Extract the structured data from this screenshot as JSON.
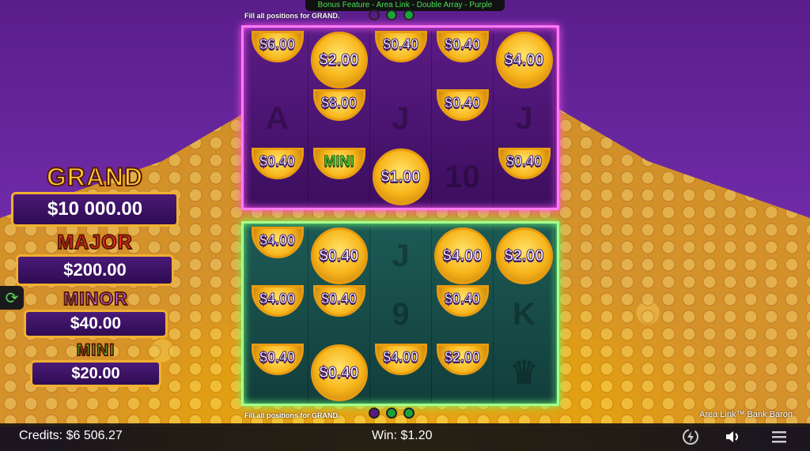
{
  "banner": "Bonus Feature - Area Link - Double Array - Purple",
  "hint": "Fill all positions for GRAND.",
  "top_grid": [
    [
      {
        "coin": "$6.00",
        "partial": true
      },
      {
        "coin": "$2.00"
      },
      {
        "coin": "$0.40",
        "partial": true
      },
      {
        "coin": "$0.40",
        "partial": true
      },
      {
        "coin": "$4.00"
      }
    ],
    [
      {
        "sym": "A"
      },
      {
        "coin": "$8.00",
        "partial": true
      },
      {
        "sym": "J"
      },
      {
        "coin": "$0.40",
        "partial": true
      },
      {
        "sym": "J"
      }
    ],
    [
      {
        "coin": "$0.40",
        "partial": true
      },
      {
        "coin": "MINI",
        "partial": true,
        "mini": true
      },
      {
        "coin": "$1.00"
      },
      {
        "sym": "10"
      },
      {
        "coin": "$0.40",
        "partial": true
      }
    ]
  ],
  "bottom_grid": [
    [
      {
        "coin": "$4.00",
        "partial": true
      },
      {
        "coin": "$0.40"
      },
      {
        "sym": "J"
      },
      {
        "coin": "$4.00"
      },
      {
        "coin": "$2.00"
      }
    ],
    [
      {
        "coin": "$4.00",
        "partial": true
      },
      {
        "coin": "$0.40",
        "partial": true
      },
      {
        "sym": "9"
      },
      {
        "coin": "$0.40",
        "partial": true
      },
      {
        "sym": "K"
      }
    ],
    [
      {
        "coin": "$0.40",
        "partial": true
      },
      {
        "coin": "$0.40"
      },
      {
        "coin": "$4.00",
        "partial": true
      },
      {
        "coin": "$2.00",
        "partial": true
      },
      {
        "sym": "♛"
      }
    ]
  ],
  "jackpots": {
    "grand": {
      "label": "GRAND",
      "value": "$10 000.00"
    },
    "major": {
      "label": "MAJOR",
      "value": "$200.00"
    },
    "minor": {
      "label": "MINOR",
      "value": "$40.00"
    },
    "mini": {
      "label": "MINI",
      "value": "$20.00"
    }
  },
  "brand": "Area Link™ Bank Baron",
  "credits": "Credits: $6 506.27",
  "win": "Win: $1.20",
  "colors": {
    "grand": "#ffcf3a",
    "major": "#ff3030",
    "minor": "#c070ff",
    "mini": "#50e040"
  }
}
